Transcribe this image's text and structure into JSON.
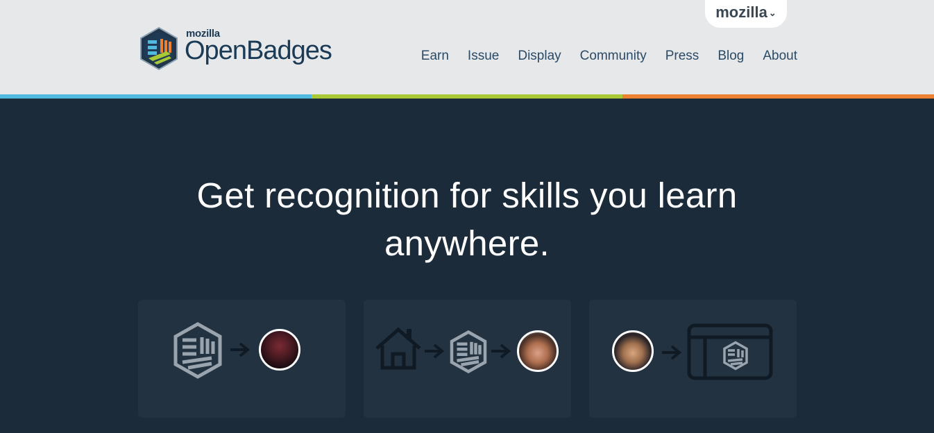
{
  "header": {
    "logo_small": "mozilla",
    "logo_big": "OpenBadges",
    "mozilla_tab": "mozilla"
  },
  "nav": {
    "items": [
      "Earn",
      "Issue",
      "Display",
      "Community",
      "Press",
      "Blog",
      "About"
    ]
  },
  "colors": {
    "stripe": [
      "#4fb9df",
      "#a9c836",
      "#ec8231"
    ],
    "background": "#1b2b3a",
    "card": "#223241"
  },
  "hero": {
    "line1": "Get recognition for skills you learn",
    "line2": "anywhere."
  },
  "cards": [
    {
      "icons": [
        "badge-icon",
        "arrow-right-icon",
        "avatar"
      ]
    },
    {
      "icons": [
        "house-icon",
        "arrow-right-icon",
        "badge-icon",
        "arrow-right-icon",
        "avatar"
      ]
    },
    {
      "icons": [
        "avatar",
        "arrow-right-icon",
        "browser-window-icon"
      ]
    }
  ]
}
